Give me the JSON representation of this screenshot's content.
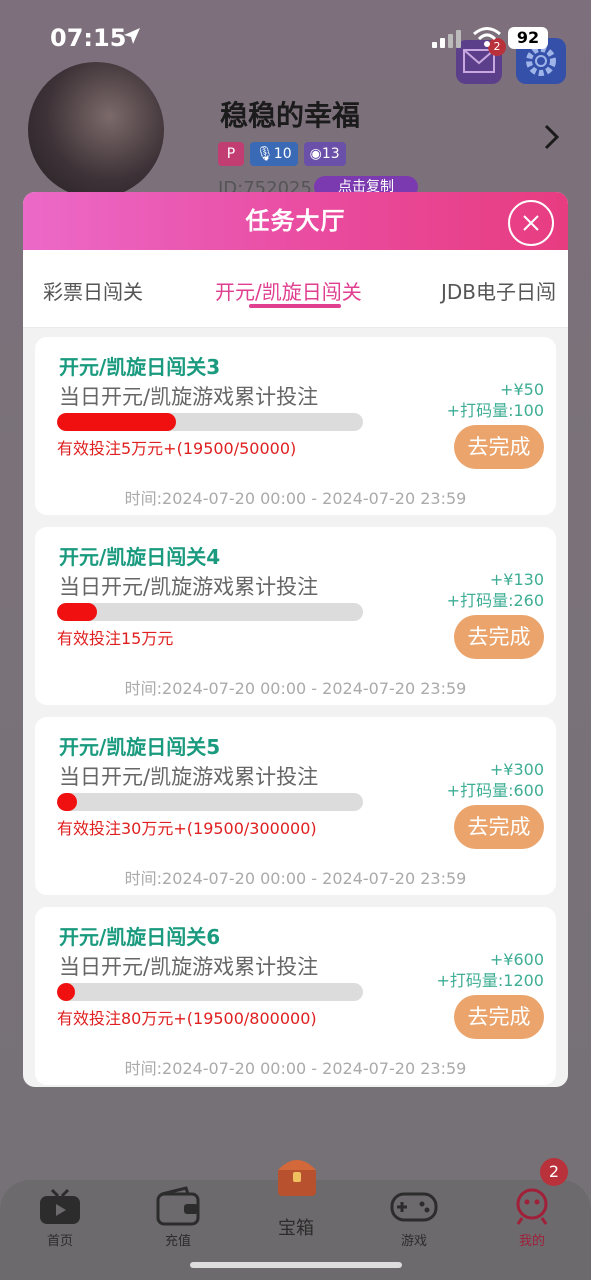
{
  "status_bar": {
    "time": "07:15",
    "battery": "92"
  },
  "profile": {
    "mail_badge": "2",
    "username": "稳稳的幸福",
    "chips": {
      "mic": "10",
      "coin": "13"
    },
    "user_id": "ID:752025",
    "copy_label": "点击复制"
  },
  "modal": {
    "title": "任务大厅",
    "tabs": [
      {
        "label": "彩票日闯关"
      },
      {
        "label": "开元/凯旋日闯关"
      },
      {
        "label": "JDB电子日闯"
      }
    ],
    "tasks": [
      {
        "title": "开元/凯旋日闯关3",
        "desc": "当日开元/凯旋游戏累计投注",
        "progress_fraction": 0.39,
        "progress_text": "有效投注5万元+(19500/50000)",
        "reward_money": "+¥50",
        "reward_wager": "+打码量:100",
        "button": "去完成",
        "time": "时间:2024-07-20 00:00 - 2024-07-20 23:59"
      },
      {
        "title": "开元/凯旋日闯关4",
        "desc": "当日开元/凯旋游戏累计投注",
        "progress_fraction": 0.13,
        "progress_text": "有效投注15万元",
        "reward_money": "+¥130",
        "reward_wager": "+打码量:260",
        "button": "去完成",
        "time": "时间:2024-07-20 00:00 - 2024-07-20 23:59"
      },
      {
        "title": "开元/凯旋日闯关5",
        "desc": "当日开元/凯旋游戏累计投注",
        "progress_fraction": 0.065,
        "progress_text": "有效投注30万元+(19500/300000)",
        "reward_money": "+¥300",
        "reward_wager": "+打码量:600",
        "button": "去完成",
        "time": "时间:2024-07-20 00:00 - 2024-07-20 23:59"
      },
      {
        "title": "开元/凯旋日闯关6",
        "desc": "当日开元/凯旋游戏累计投注",
        "progress_fraction": 0.024,
        "progress_text": "有效投注80万元+(19500/800000)",
        "reward_money": "+¥600",
        "reward_wager": "+打码量:1200",
        "button": "去完成",
        "time": "时间:2024-07-20 00:00 - 2024-07-20 23:59"
      }
    ]
  },
  "bottom_nav": {
    "items": [
      {
        "label": "首页"
      },
      {
        "label": "充值"
      },
      {
        "label": "宝箱"
      },
      {
        "label": "游戏"
      },
      {
        "label": "我的"
      }
    ],
    "mine_badge": "2"
  },
  "colors": {
    "accent_pink": "#e03e8f",
    "task_title_green": "#1a9a7e",
    "progress_red": "#f01010",
    "button_orange": "#eba46c"
  },
  "icons": [
    "location-arrow-icon",
    "signal-icon",
    "wifi-icon",
    "mail-icon",
    "gear-icon",
    "chevron-right-icon",
    "close-icon",
    "tv-icon",
    "wallet-icon",
    "chest-icon",
    "gamepad-icon",
    "profile-icon"
  ]
}
